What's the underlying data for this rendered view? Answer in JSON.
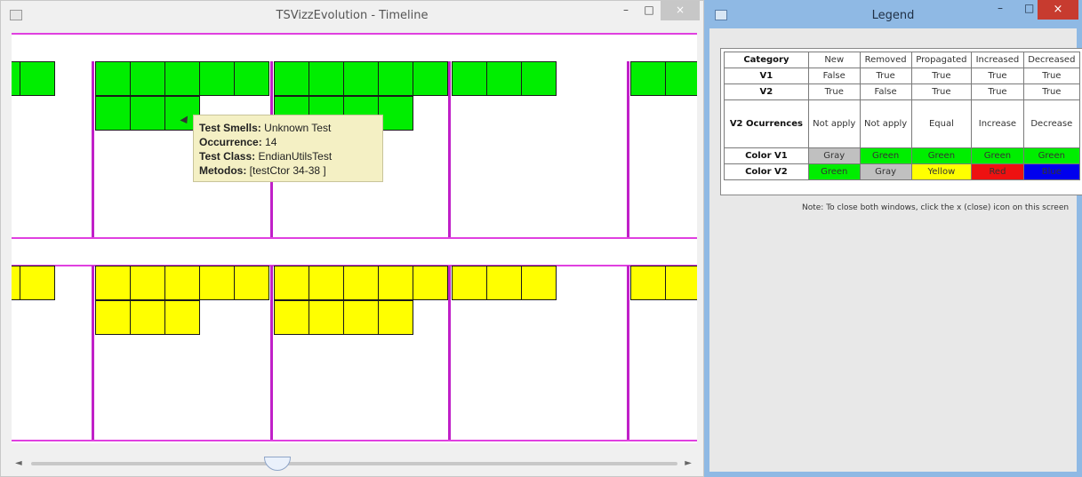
{
  "timeline_window": {
    "title": "TSVizzEvolution - Timeline",
    "minimize_label": "–",
    "maximize_label": "□",
    "close_label": "×"
  },
  "tooltip": {
    "test_smells_label": "Test Smells:",
    "test_smells_value": "Unknown Test",
    "occurrence_label": "Occurrence:",
    "occurrence_value": "14",
    "test_class_label": "Test Class:",
    "test_class_value": "EndianUtilsTest",
    "metodos_label": "Metodos:",
    "metodos_value": "[testCtor 34-38 ]"
  },
  "legend_window": {
    "title": "Legend",
    "minimize_label": "–",
    "maximize_label": "□",
    "close_label": "×",
    "table": {
      "header": [
        "Category",
        "New",
        "Removed",
        "Propagated",
        "Increased",
        "Decreased"
      ],
      "v1": [
        "V1",
        "False",
        "True",
        "True",
        "True",
        "True"
      ],
      "v2": [
        "V2",
        "True",
        "False",
        "True",
        "True",
        "True"
      ],
      "ocurrences": [
        "V2 Ocurrences",
        "Not apply",
        "Not apply",
        "Equal",
        "Increase",
        "Decrease"
      ],
      "color_v1": [
        "Color V1",
        "Gray",
        "Green",
        "Green",
        "Green",
        "Green"
      ],
      "color_v2": [
        "Color V2",
        "Green",
        "Gray",
        "Yellow",
        "Red",
        "Blue"
      ]
    },
    "note": "Note: To close both windows, click the x (close) icon on this screen"
  },
  "colors": {
    "green": "#00ee00",
    "yellow": "#ffff00",
    "gray": "#c0c0c0",
    "red": "#ee1111",
    "blue": "#0000ee",
    "grid_lines": "#e040e0"
  }
}
